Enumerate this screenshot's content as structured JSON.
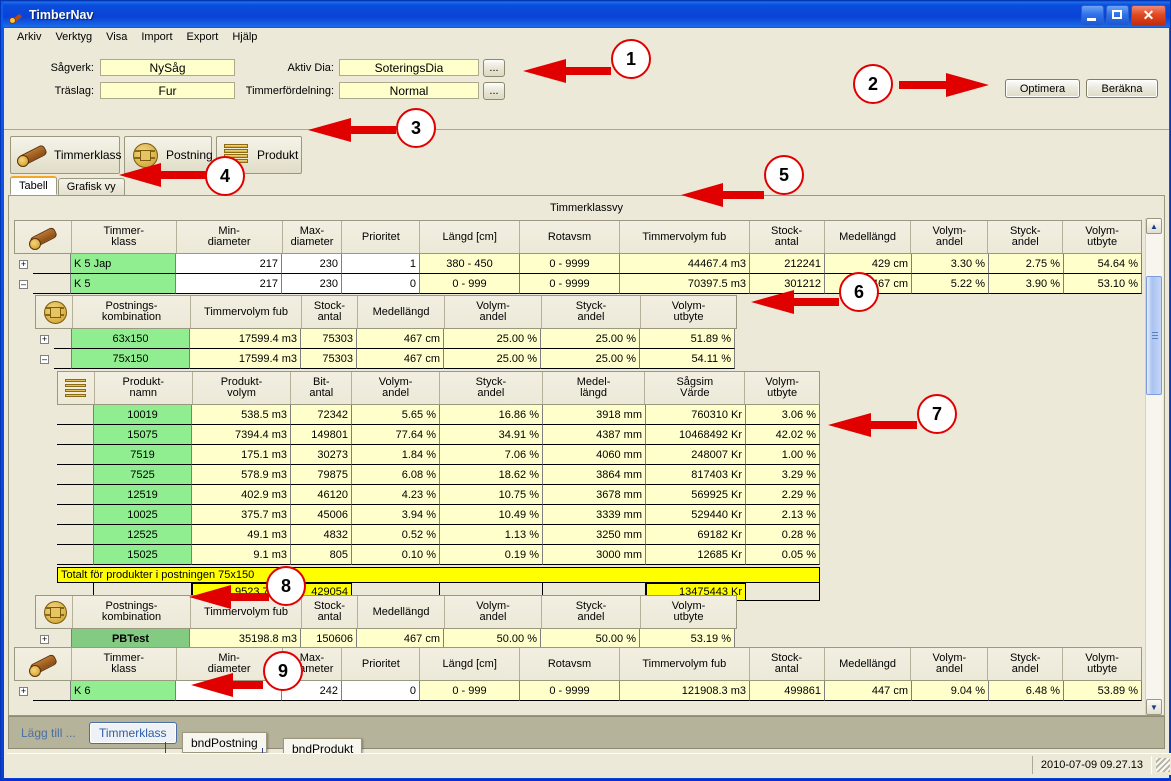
{
  "window": {
    "title": "TimberNav",
    "icon": "log-icon",
    "minimize": "–",
    "maximize": "□",
    "close": "✕"
  },
  "menu": [
    "Arkiv",
    "Verktyg",
    "Visa",
    "Import",
    "Export",
    "Hjälp"
  ],
  "form": {
    "sagverk_label": "Sågverk:",
    "sagverk_value": "NySåg",
    "traslag_label": "Träslag:",
    "traslag_value": "Fur",
    "aktivdia_label": "Aktiv Dia:",
    "aktivdia_value": "SoteringsDia",
    "timmerfordelning_label": "Timmerfördelning:",
    "timmerfordelning_value": "Normal",
    "browse_button": "...",
    "optimera_button": "Optimera",
    "berakna_button": "Beräkna"
  },
  "toolbar": {
    "timmerklass": "Timmerklass",
    "postning": "Postning",
    "produkt": "Produkt"
  },
  "tabs": [
    {
      "label": "Tabell",
      "active": true
    },
    {
      "label": "Grafisk vy",
      "active": false
    }
  ],
  "panel_title": "Timmerklassvy",
  "timmerklass_grid": {
    "columns": [
      "Timmer-\nklass",
      "Min-\ndiameter",
      "Max-\ndiameter",
      "Prioritet",
      "Längd [cm]",
      "Rotavsm",
      "Timmervolym fub",
      "Stock-\nantal",
      "Medellängd",
      "Volym-\nandel",
      "Styck-\nandel",
      "Volym-\nutbyte"
    ],
    "rows": [
      {
        "expander": "+",
        "name": "K 5 Jap",
        "min": "217",
        "max": "230",
        "prioritet": "1",
        "langd": "380 - 450",
        "rotavsm": "0 - 9999",
        "volym": "44467.4 m3",
        "stock": "212241",
        "medel": "429 cm",
        "vandel": "3.30 %",
        "sandel": "2.75 %",
        "vutbyte": "54.64 %"
      },
      {
        "expander": "–",
        "name": "K 5",
        "min": "217",
        "max": "230",
        "prioritet": "0",
        "langd": "0 - 999",
        "rotavsm": "0 - 9999",
        "volym": "70397.5 m3",
        "stock": "301212",
        "medel": "467 cm",
        "vandel": "5.22 %",
        "sandel": "3.90 %",
        "vutbyte": "53.10 %"
      }
    ]
  },
  "postning_grid": {
    "columns": [
      "Postnings-\nkombination",
      "Timmervolym fub",
      "Stock-\nantal",
      "Medellängd",
      "Volym-\nandel",
      "Styck-\nandel",
      "Volym-\nutbyte"
    ],
    "rows": [
      {
        "expander": "+",
        "name": "63x150",
        "volym": "17599.4 m3",
        "stock": "75303",
        "medel": "467 cm",
        "vandel": "25.00 %",
        "sandel": "25.00 %",
        "vutbyte": "51.89 %"
      },
      {
        "expander": "–",
        "name": "75x150",
        "volym": "17599.4 m3",
        "stock": "75303",
        "medel": "467 cm",
        "vandel": "25.00 %",
        "sandel": "25.00 %",
        "vutbyte": "54.11 %"
      }
    ]
  },
  "produkt_grid": {
    "columns": [
      "Produkt-\nnamn",
      "Produkt-\nvolym",
      "Bit-\nantal",
      "Volym-\nandel",
      "Styck-\nandel",
      "Medel-\nlängd",
      "Sågsim\nVärde",
      "Volym-\nutbyte"
    ],
    "rows": [
      {
        "namn": "10019",
        "volym": "538.5 m3",
        "bit": "72342",
        "vandel": "5.65 %",
        "sandel": "16.86 %",
        "medel": "3918 mm",
        "varde": "760310 Kr",
        "vutbyte": "3.06 %"
      },
      {
        "namn": "15075",
        "volym": "7394.4 m3",
        "bit": "149801",
        "vandel": "77.64 %",
        "sandel": "34.91 %",
        "medel": "4387 mm",
        "varde": "10468492 Kr",
        "vutbyte": "42.02 %"
      },
      {
        "namn": "7519",
        "volym": "175.1 m3",
        "bit": "30273",
        "vandel": "1.84 %",
        "sandel": "7.06 %",
        "medel": "4060 mm",
        "varde": "248007 Kr",
        "vutbyte": "1.00 %"
      },
      {
        "namn": "7525",
        "volym": "578.9 m3",
        "bit": "79875",
        "vandel": "6.08 %",
        "sandel": "18.62 %",
        "medel": "3864 mm",
        "varde": "817403 Kr",
        "vutbyte": "3.29 %"
      },
      {
        "namn": "12519",
        "volym": "402.9 m3",
        "bit": "46120",
        "vandel": "4.23 %",
        "sandel": "10.75 %",
        "medel": "3678 mm",
        "varde": "569925 Kr",
        "vutbyte": "2.29 %"
      },
      {
        "namn": "10025",
        "volym": "375.7 m3",
        "bit": "45006",
        "vandel": "3.94 %",
        "sandel": "10.49 %",
        "medel": "3339 mm",
        "varde": "529440 Kr",
        "vutbyte": "2.13 %"
      },
      {
        "namn": "12525",
        "volym": "49.1 m3",
        "bit": "4832",
        "vandel": "0.52 %",
        "sandel": "1.13 %",
        "medel": "3250 mm",
        "varde": "69182 Kr",
        "vutbyte": "0.28 %"
      },
      {
        "namn": "15025",
        "volym": "9.1 m3",
        "bit": "805",
        "vandel": "0.10 %",
        "sandel": "0.19 %",
        "medel": "3000 mm",
        "varde": "12685 Kr",
        "vutbyte": "0.05 %"
      }
    ],
    "total_label": "Totalt för produkter i postningen 75x150",
    "total_volym": "9523.7 m3",
    "total_bit": "429054",
    "total_varde": "13475443 Kr"
  },
  "postning_grid2": {
    "columns": [
      "Postnings-\nkombination",
      "Timmervolym fub",
      "Stock-\nantal",
      "Medellängd",
      "Volym-\nandel",
      "Styck-\nandel",
      "Volym-\nutbyte"
    ],
    "rows": [
      {
        "expander": "+",
        "name": "PBTest",
        "volym": "35198.8 m3",
        "stock": "150606",
        "medel": "467 cm",
        "vandel": "50.00 %",
        "sandel": "50.00 %",
        "vutbyte": "53.19 %"
      }
    ]
  },
  "timmerklass_grid2": {
    "columns": [
      "Timmer-\nklass",
      "Min-\ndiameter",
      "Max-\ndiameter",
      "Prioritet",
      "Längd [cm]",
      "Rotavsm",
      "Timmervolym fub",
      "Stock-\nantal",
      "Medellängd",
      "Volym-\nandel",
      "Styck-\nandel",
      "Volym-\nutbyte"
    ],
    "rows": [
      {
        "expander": "+",
        "name": "K 6",
        "min": "",
        "max": "242",
        "prioritet": "0",
        "langd": "0 - 999",
        "rotavsm": "0 - 9999",
        "volym": "121908.3 m3",
        "stock": "499861",
        "medel": "447 cm",
        "vandel": "9.04 %",
        "sandel": "6.48 %",
        "vutbyte": "53.89 %"
      }
    ]
  },
  "bottom": {
    "add_label": "Lägg till ...",
    "timmerklass_button": "Timmerklass",
    "callout_postning": "bndPostning",
    "callout_produkt": "bndProdukt"
  },
  "status": {
    "timestamp": "2010-07-09 09.27.13"
  },
  "annotations": [
    {
      "n": "1"
    },
    {
      "n": "2"
    },
    {
      "n": "3"
    },
    {
      "n": "4"
    },
    {
      "n": "5"
    },
    {
      "n": "6"
    },
    {
      "n": "7"
    },
    {
      "n": "8"
    },
    {
      "n": "9"
    }
  ],
  "colors": {
    "title_blue": "#0a42d6",
    "face": "#ece9d8",
    "cell_yellow": "#ffffcc",
    "name_green": "#90ee90",
    "total_yellow": "#ffff00",
    "annotation_red": "#e00000"
  }
}
